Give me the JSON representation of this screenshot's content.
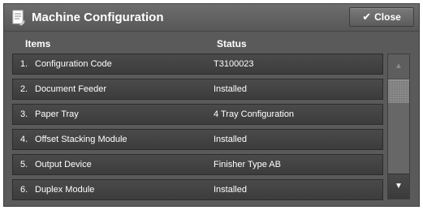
{
  "window": {
    "title": "Machine Configuration",
    "title_icon": "document-icon"
  },
  "toolbar": {
    "close_label": "Close",
    "close_icon": "checkmark-icon"
  },
  "table": {
    "headers": {
      "items": "Items",
      "status": "Status"
    },
    "rows": [
      {
        "num": "1.",
        "name": "Configuration Code",
        "status": "T3100023"
      },
      {
        "num": "2.",
        "name": "Document Feeder",
        "status": "Installed"
      },
      {
        "num": "3.",
        "name": "Paper Tray",
        "status": "4 Tray Configuration"
      },
      {
        "num": "4.",
        "name": "Offset Stacking Module",
        "status": "Installed"
      },
      {
        "num": "5.",
        "name": "Output Device",
        "status": "Finisher Type AB"
      },
      {
        "num": "6.",
        "name": "Duplex Module",
        "status": "Installed"
      }
    ]
  },
  "scrollbar": {
    "up_icon": "triangle-up-icon",
    "down_icon": "triangle-down-icon",
    "up_enabled": false,
    "down_enabled": true
  },
  "colors": {
    "panel": "#5a5a5a",
    "row": "#444444",
    "text": "#ffffff"
  }
}
